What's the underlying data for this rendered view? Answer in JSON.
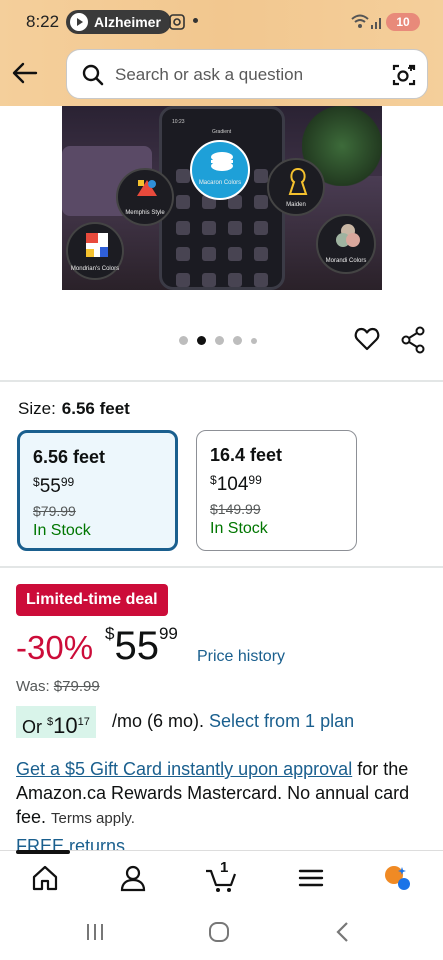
{
  "status_bar": {
    "time": "8:22",
    "media_pill_label": "Alzheimer",
    "battery": "10"
  },
  "header": {
    "search_placeholder": "Search or ask a question"
  },
  "hero": {
    "phone_time": "10:23",
    "phone_title": "Gradient",
    "bubbles": {
      "macaron": "Macaron Colors",
      "memphis": "Memphis Style",
      "maiden": "Maiden",
      "mondrian": "Mondrian's Colors",
      "morandi": "Morandi Colors"
    }
  },
  "carousel": {
    "count": 5,
    "active_index": 1
  },
  "size": {
    "label": "Size:",
    "selected": "6.56 feet",
    "options": [
      {
        "title": "6.56 feet",
        "currency": "$",
        "price_whole": "55",
        "price_cents": "99",
        "old_price": "$79.99",
        "stock": "In Stock"
      },
      {
        "title": "16.4 feet",
        "currency": "$",
        "price_whole": "104",
        "price_cents": "99",
        "old_price": "$149.99",
        "stock": "In Stock"
      }
    ]
  },
  "deal": {
    "badge": "Limited-time deal",
    "discount": "-30%",
    "currency": "$",
    "price_whole": "55",
    "price_cents": "99",
    "price_history": "Price history",
    "was_label": "Was:",
    "was_price": "$79.99"
  },
  "plan": {
    "prefix": "Or",
    "currency": "$",
    "whole": "10",
    "cents": "17",
    "suffix": "/mo (6 mo).",
    "link": "Select from 1 plan"
  },
  "gift": {
    "link": "Get a $5 Gift Card instantly upon approval",
    "text": "for the Amazon.ca Rewards Mastercard. No annual card fee.",
    "terms": "Terms apply."
  },
  "free_returns": "FREE returns",
  "tabbar": {
    "cart_count": "1"
  },
  "colors": {
    "accent": "#1a5f8e",
    "deal": "#cc0c39",
    "stock": "#007600",
    "header": "#f2c78f"
  }
}
